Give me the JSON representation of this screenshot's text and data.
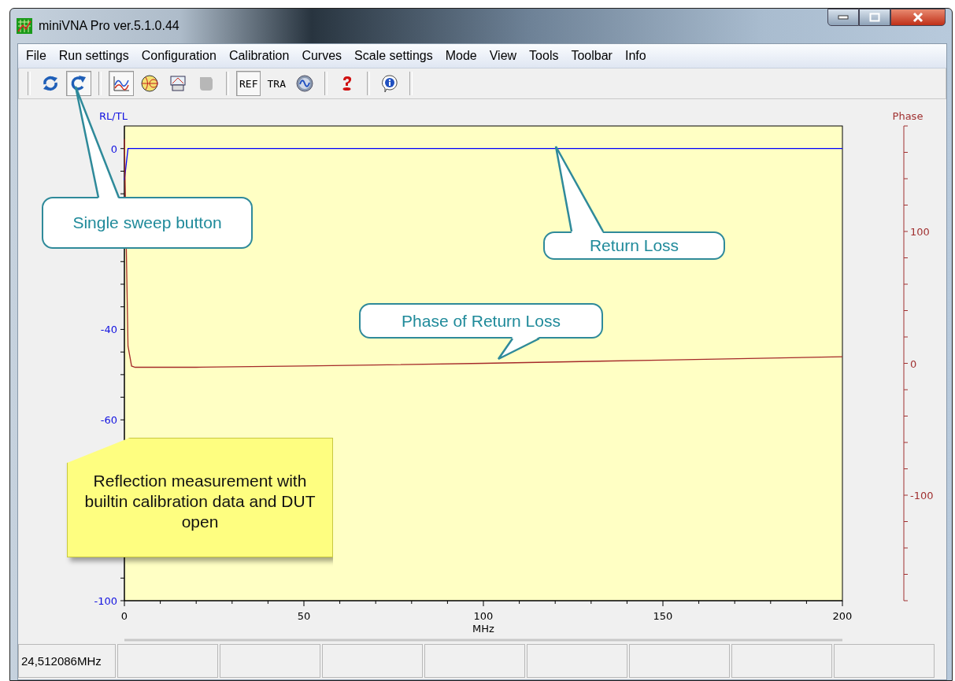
{
  "window": {
    "title": "miniVNA Pro ver.5.1.0.44"
  },
  "menu": [
    "File",
    "Run settings",
    "Configuration",
    "Calibration",
    "Curves",
    "Scale settings",
    "Mode",
    "View",
    "Tools",
    "Toolbar",
    "Info"
  ],
  "toolbar": [
    {
      "items": [
        {
          "kind": "icon",
          "pressed": false,
          "disabled": false
        },
        {
          "kind": "icon",
          "pressed": true,
          "disabled": false
        }
      ]
    },
    {
      "items": [
        {
          "kind": "icon",
          "pressed": true,
          "disabled": false
        },
        {
          "kind": "icon",
          "pressed": false,
          "disabled": false
        },
        {
          "kind": "icon",
          "pressed": false,
          "disabled": false
        },
        {
          "kind": "icon",
          "pressed": false,
          "disabled": true
        }
      ]
    },
    {
      "items": [
        {
          "kind": "text",
          "label": "REF",
          "pressed": true,
          "disabled": false
        },
        {
          "kind": "text",
          "label": "TRA",
          "pressed": false,
          "disabled": false
        },
        {
          "kind": "icon",
          "pressed": false,
          "disabled": false
        }
      ]
    },
    {
      "items": [
        {
          "kind": "icon",
          "pressed": false,
          "disabled": false
        }
      ]
    },
    {
      "items": [
        {
          "kind": "icon",
          "pressed": false,
          "disabled": false
        }
      ]
    }
  ],
  "chart_data": {
    "type": "line",
    "xlabel": "MHz",
    "ylabel": "RL/TL",
    "xlim": [
      0,
      200
    ],
    "ylim": [
      -100,
      5
    ],
    "xticks": [
      0,
      50,
      100,
      150,
      200
    ],
    "yticks": [
      0,
      -40,
      -60,
      -100
    ],
    "y2label": "Phase",
    "y2lim": [
      -180,
      180
    ],
    "y2ticks": [
      100,
      0,
      -100
    ],
    "x": [
      0,
      1,
      2,
      3,
      5,
      20,
      50,
      100,
      150,
      200
    ],
    "series": [
      {
        "color": "#0000ff",
        "values": [
          -7,
          0,
          0,
          0,
          0,
          0,
          0,
          0,
          0,
          0
        ]
      },
      {
        "color": "#a52a2a",
        "axis": "y2",
        "values": [
          170,
          13,
          -2,
          -3,
          -3,
          -3,
          -2,
          0,
          2.5,
          5
        ]
      }
    ]
  },
  "callouts": [
    {
      "kind": "bubble",
      "text": "Single sweep button"
    },
    {
      "kind": "bubble",
      "text": "Return Loss"
    },
    {
      "kind": "bubble",
      "text": "Phase of Return Loss"
    },
    {
      "kind": "note",
      "text": "Reflection measurement with builtin calibration data and DUT open"
    }
  ],
  "status_bar": {
    "frequency": "24,512086MHz"
  }
}
